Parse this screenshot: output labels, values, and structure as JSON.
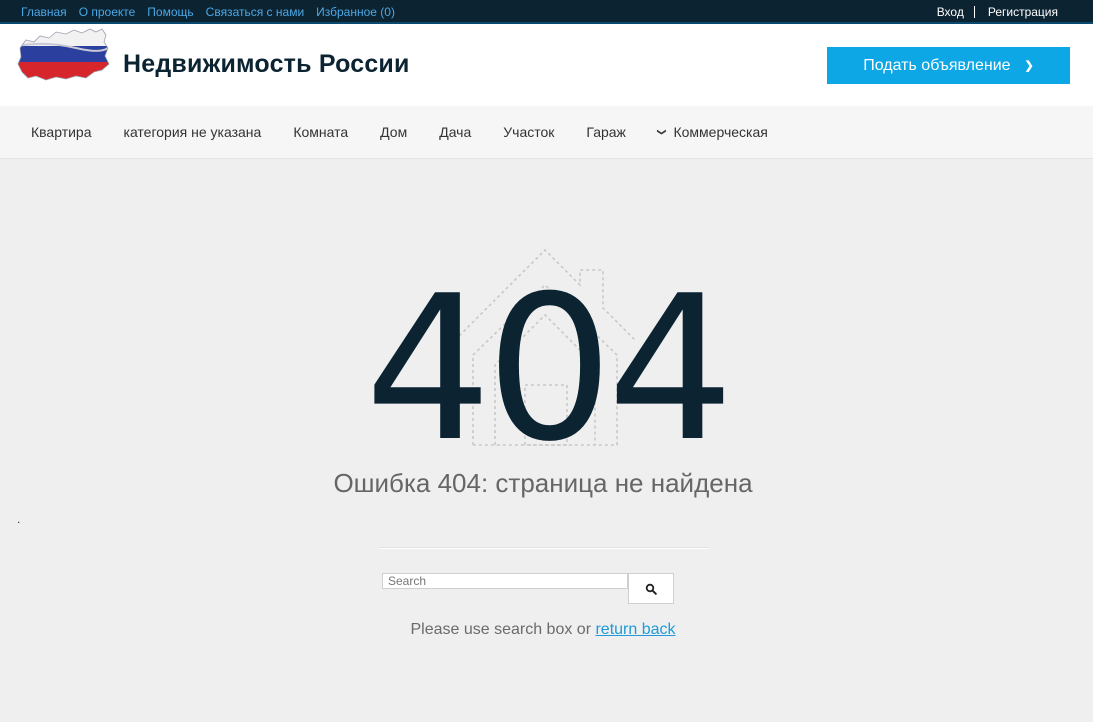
{
  "topbar": {
    "links": [
      "Главная",
      "О проекте",
      "Помощь",
      "Связаться с нами",
      "Избранное (0)"
    ],
    "login": "Вход",
    "register": "Регистрация"
  },
  "header": {
    "title": "Недвижимость России",
    "post_button": "Подать объявление",
    "post_button_icon": "chevron-right-icon"
  },
  "nav": {
    "items": [
      "Квартира",
      "категория не указана",
      "Комната",
      "Дом",
      "Дача",
      "Участок",
      "Гараж"
    ],
    "dropdown_item": "Коммерческая",
    "dropdown_icon": "chevron-down-icon"
  },
  "error": {
    "code": "404",
    "message": "Ошибка 404: страница не найдена",
    "stray_dot": "."
  },
  "search": {
    "placeholder": "Search",
    "button_icon": "search-icon"
  },
  "help": {
    "text": "Please use search box or ",
    "link": "return back"
  },
  "colors": {
    "topbar_bg": "#0c2332",
    "accent": "#0ea7e6",
    "title": "#0c2332",
    "link": "#1e9bd8"
  }
}
